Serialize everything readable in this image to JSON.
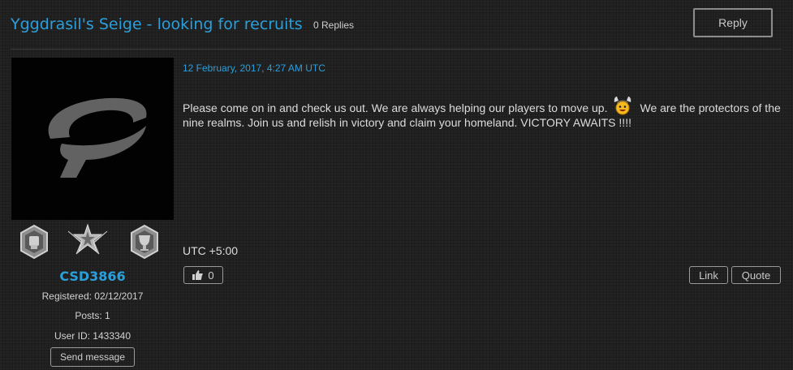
{
  "thread": {
    "title": "Yggdrasil's Seige - looking for recruits",
    "replies": "0 Replies",
    "reply_label": "Reply"
  },
  "author": {
    "avatar_icon": "paradox-logo-icon",
    "badges": [
      "fist-badge-icon",
      "star-wings-badge-icon",
      "trophy-badge-icon"
    ],
    "username": "CSD3866",
    "registered": "Registered: 02/12/2017",
    "posts": "Posts: 1",
    "user_id": "User ID: 1433340",
    "send_message_label": "Send message"
  },
  "post": {
    "date": "12 February, 2017, 4:27 AM UTC",
    "text_before_emoji": "Please come on in and check us out. We are always helping our players to move up.",
    "emoji_icon": "viking-smiley-icon",
    "text_after_emoji": "We are the protectors of the nine realms. Join us and relish in victory and claim your homeland. VICTORY AWAITS !!!!",
    "timezone": "UTC +5:00",
    "like_count": "0",
    "link_label": "Link",
    "quote_label": "Quote"
  },
  "colors": {
    "accent": "#2a9fdc",
    "background": "#1f1f1f",
    "text": "#d8d8d8"
  }
}
